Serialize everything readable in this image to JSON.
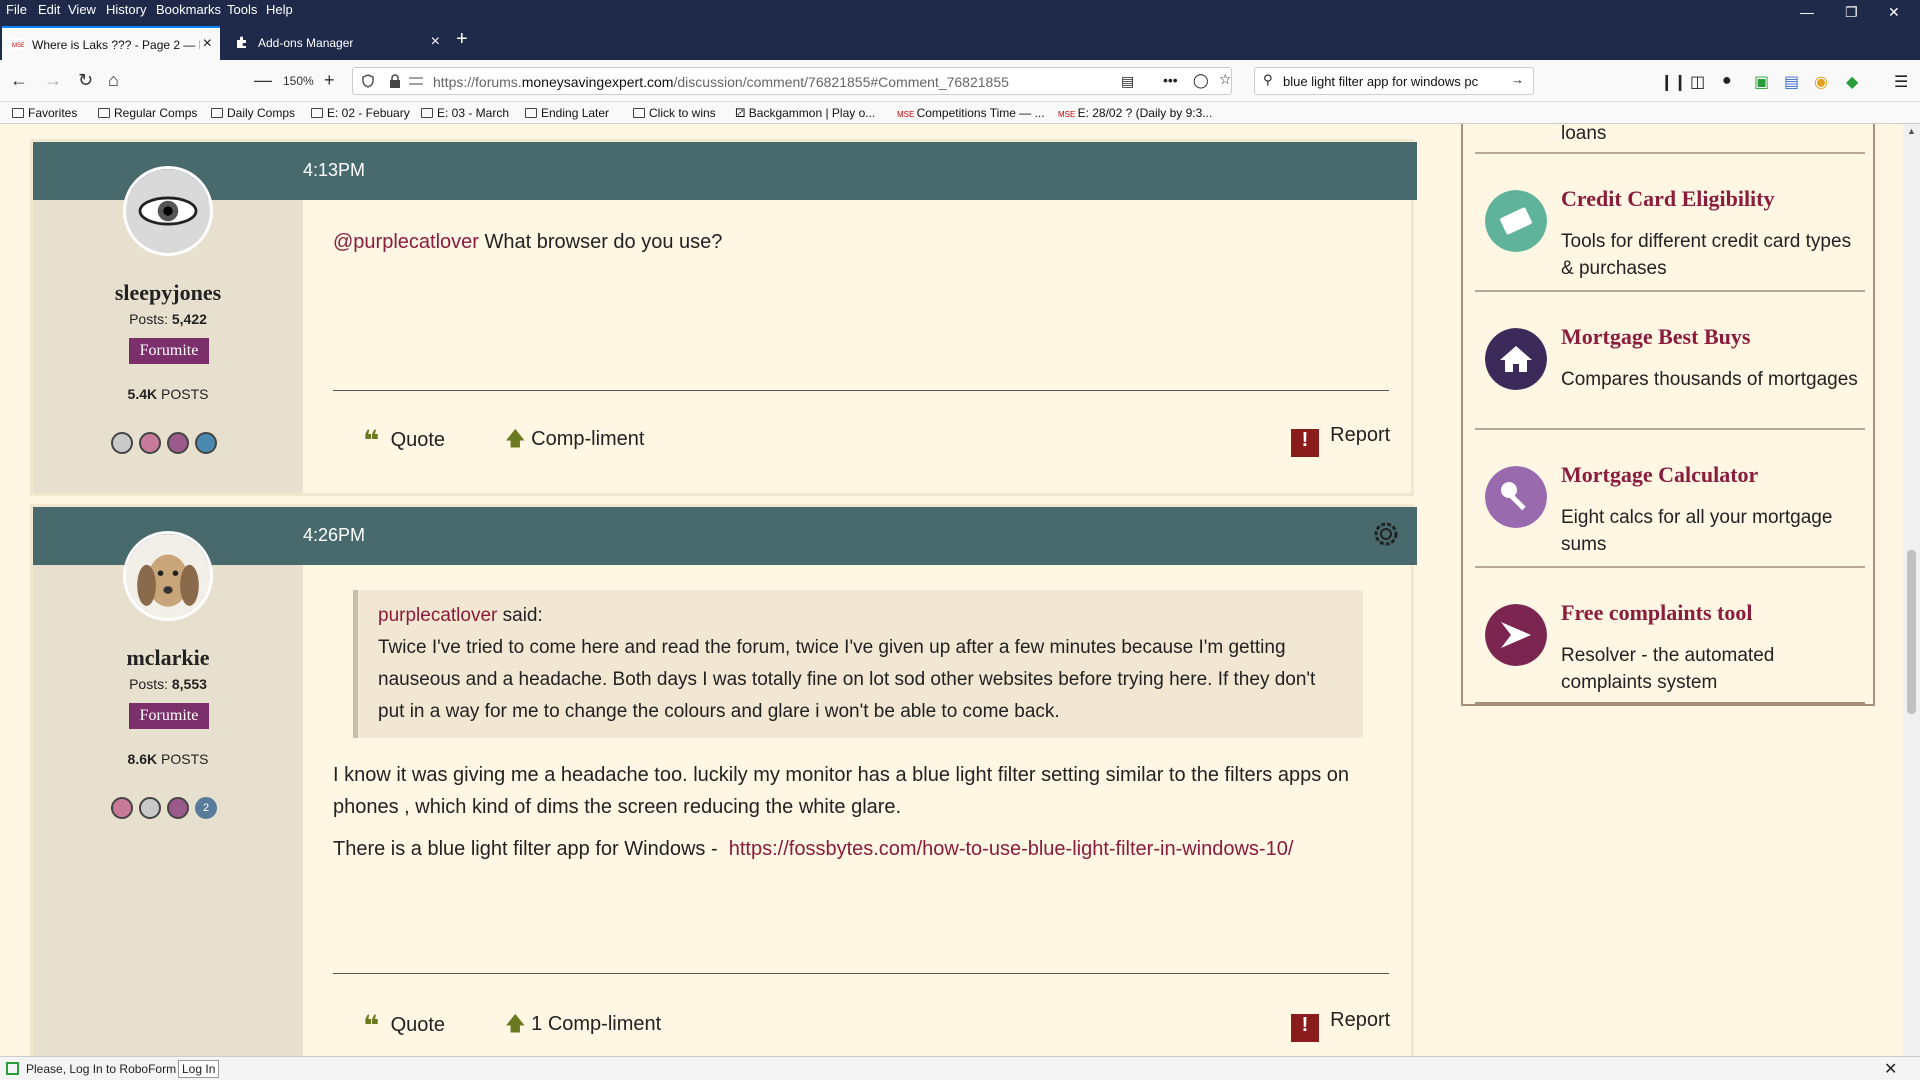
{
  "menu": [
    "File",
    "Edit",
    "View",
    "History",
    "Bookmarks",
    "Tools",
    "Help"
  ],
  "tabs": [
    {
      "label": "Where is Laks ??? - Page 2 — M",
      "active": true
    },
    {
      "label": "Add-ons Manager",
      "active": false
    }
  ],
  "nav": {
    "zoom": "150%",
    "url_prefix": "https://forums.",
    "url_domain": "moneysavingexpert.com",
    "url_path": "/discussion/comment/76821855#Comment_76821855",
    "search_value": "blue light filter app for windows pc"
  },
  "bookmarks": [
    "Favorites",
    "Regular Comps",
    "Daily Comps",
    "E: 02 - Febuary",
    "E: 03 - March",
    "Ending Later",
    "Click to wins",
    "Backgammon | Play o...",
    "Competitions Time — ...",
    "E: 28/02 ? (Daily by 9:3..."
  ],
  "posts": [
    {
      "time": "4:13PM",
      "username": "sleepyjones",
      "posts_label": "Posts:",
      "posts_count": "5,422",
      "badge": "Forumite",
      "postcount_num": "5.4K",
      "postcount_label": "POSTS",
      "mention": "@purplecatlover",
      "text": "What browser do you use?",
      "quote_label": "Quote",
      "compliment_label": "Comp-liment",
      "report_label": "Report"
    },
    {
      "time": "4:26PM",
      "username": "mclarkie",
      "posts_label": "Posts:",
      "posts_count": "8,553",
      "badge": "Forumite",
      "postcount_num": "8.6K",
      "postcount_label": "POSTS",
      "award_count": "2",
      "quote_author": "purplecatlover",
      "quote_said": "said:",
      "quote_text": "Twice I've tried to come here and read the forum, twice I've given up after a few minutes because I'm getting nauseous and a headache. Both days I was totally fine on lot sod other websites before trying here. If they don't put in a way for me to change the colours and glare i won't be able to come back.",
      "text1": "I know it was giving me a headache too. luckily my monitor has a blue light filter setting similar to the filters apps on phones , which kind of dims the screen reducing the white glare.",
      "text2": "There is a blue light filter app for Windows - ",
      "link": "https://fossbytes.com/how-to-use-blue-light-filter-in-windows-10/",
      "quote_label": "Quote",
      "compliment_count": "1",
      "compliment_label": "Comp-liment",
      "report_label": "Report"
    }
  ],
  "sidebar": {
    "partial": "loans",
    "items": [
      {
        "title": "Credit Card Eligibility",
        "desc": "Tools for different credit card types & purchases",
        "color": "#5fb39a"
      },
      {
        "title": "Mortgage Best Buys",
        "desc": "Compares thousands of mortgages",
        "color": "#3b2a5a"
      },
      {
        "title": "Mortgage Calculator",
        "desc": "Eight calcs for all your mortgage sums",
        "color": "#9a6aae"
      },
      {
        "title": "Free complaints tool",
        "desc": "Resolver - the automated complaints system",
        "color": "#7b2550"
      }
    ]
  },
  "status": {
    "text": "Please, Log In to RoboForm",
    "button": "Log In"
  }
}
